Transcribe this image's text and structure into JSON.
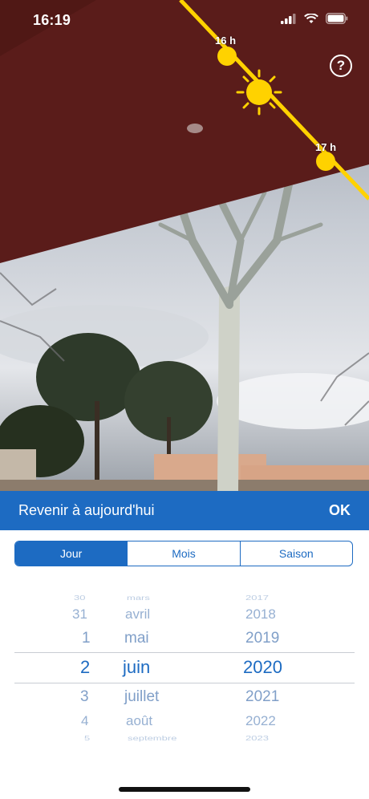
{
  "status_bar": {
    "time": "16:19"
  },
  "camera": {
    "hour_labels": [
      "16 h",
      "17 h"
    ],
    "help_glyph": "?"
  },
  "action_bar": {
    "back_today_label": "Revenir à aujourd'hui",
    "ok_label": "OK"
  },
  "segments": [
    {
      "label": "Jour",
      "selected": true
    },
    {
      "label": "Mois",
      "selected": false
    },
    {
      "label": "Saison",
      "selected": false
    }
  ],
  "picker": {
    "days": [
      "30",
      "31",
      "1",
      "2",
      "3",
      "4",
      "5"
    ],
    "months": [
      "mars",
      "avril",
      "mai",
      "juin",
      "juillet",
      "août",
      "septembre"
    ],
    "years": [
      "2017",
      "2018",
      "2019",
      "2020",
      "2021",
      "2022",
      "2023"
    ],
    "selected": {
      "day": "2",
      "month": "juin",
      "year": "2020"
    }
  },
  "colors": {
    "accent": "#1d6bc2",
    "sun": "#ffd200",
    "awning": "#5a1c1a"
  },
  "icons": [
    "help-icon",
    "sun-icon",
    "signal-icon",
    "wifi-icon",
    "battery-icon"
  ]
}
